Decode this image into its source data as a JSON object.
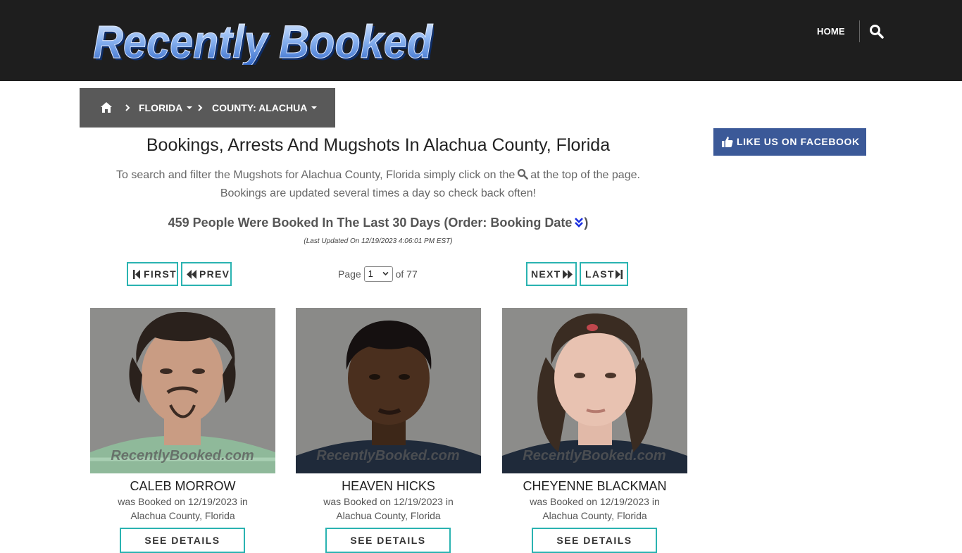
{
  "header": {
    "logo_text": "Recently Booked",
    "nav_home": "HOME",
    "search_icon": "search-icon"
  },
  "breadcrumb": {
    "home_icon": "home-icon",
    "items": [
      {
        "label": "FLORIDA"
      },
      {
        "label": "COUNTY: ALACHUA"
      }
    ]
  },
  "facebook": {
    "label": "LIKE US ON FACEBOOK",
    "icon": "thumbs-up-icon",
    "color": "#3b5998"
  },
  "main": {
    "title": "Bookings, Arrests And Mugshots In Alachua County, Florida",
    "intro_part1": "To search and filter the Mugshots for Alachua County, Florida simply click on the",
    "intro_part2": "at the top of the page.",
    "intro_line2": "Bookings are updated several times a day so check back often!",
    "count_text": "459 People Were Booked In The Last 30 Days (Order: Booking Date",
    "count_close": ")",
    "last_updated": "(Last Updated On 12/19/2023 4:06:01 PM EST)"
  },
  "pagination": {
    "first": "FIRST",
    "prev": "PREV",
    "next": "NEXT",
    "last": "LAST",
    "page_label": "Page",
    "current_page": "1",
    "of_label": "of 77",
    "accent": "#2ab3b1"
  },
  "bookings": [
    {
      "name": "CALEB MORROW",
      "line1": "was Booked on 12/19/2023 in",
      "line2": "Alachua County, Florida",
      "button": "SEE DETAILS",
      "watermark": "RecentlyBooked.com"
    },
    {
      "name": "HEAVEN HICKS",
      "line1": "was Booked on 12/19/2023 in",
      "line2": "Alachua County, Florida",
      "button": "SEE DETAILS",
      "watermark": "RecentlyBooked.com"
    },
    {
      "name": "CHEYENNE BLACKMAN",
      "line1": "was Booked on 12/19/2023 in",
      "line2": "Alachua County, Florida",
      "button": "SEE DETAILS",
      "watermark": "RecentlyBooked.com"
    }
  ]
}
